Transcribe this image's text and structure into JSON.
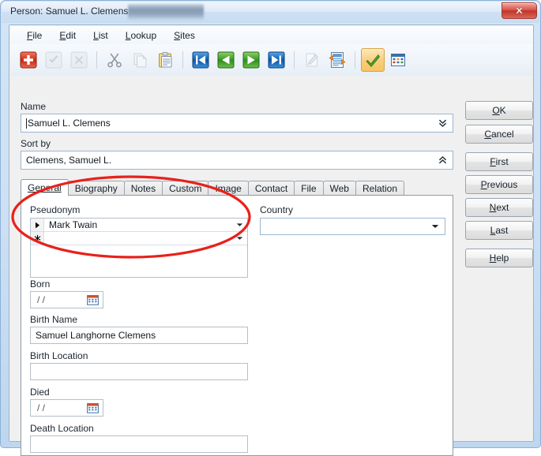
{
  "window": {
    "title": "Person: Samuel L. Clemens",
    "redacted_region": true,
    "close_label": "x"
  },
  "menubar": {
    "items": [
      {
        "label": "File",
        "accel": "F"
      },
      {
        "label": "Edit",
        "accel": "E"
      },
      {
        "label": "List",
        "accel": "L"
      },
      {
        "label": "Lookup",
        "accel": "L"
      },
      {
        "label": "Sites",
        "accel": "S"
      }
    ]
  },
  "toolbar": {
    "buttons": [
      {
        "name": "add-record-icon",
        "state": "enabled"
      },
      {
        "name": "confirm-record-icon",
        "state": "disabled"
      },
      {
        "name": "delete-record-icon",
        "state": "disabled"
      },
      {
        "name": "cut-icon",
        "state": "enabled"
      },
      {
        "name": "copy-icon",
        "state": "disabled"
      },
      {
        "name": "paste-icon",
        "state": "enabled"
      },
      {
        "name": "first-record-icon",
        "state": "enabled"
      },
      {
        "name": "previous-record-icon",
        "state": "enabled"
      },
      {
        "name": "next-record-icon",
        "state": "enabled"
      },
      {
        "name": "last-record-icon",
        "state": "enabled"
      },
      {
        "name": "edit-record-icon",
        "state": "disabled"
      },
      {
        "name": "refresh-record-icon",
        "state": "enabled"
      },
      {
        "name": "apply-check-icon",
        "state": "highlighted"
      },
      {
        "name": "grid-view-icon",
        "state": "enabled"
      }
    ]
  },
  "form": {
    "name": {
      "label": "Name",
      "value": "Samuel L. Clemens",
      "placeholder": ""
    },
    "sort_by": {
      "label": "Sort by",
      "value": "Clemens, Samuel L.",
      "placeholder": ""
    }
  },
  "tabs": {
    "items": [
      {
        "label": "General",
        "accel": "General",
        "active": true
      },
      {
        "label": "Biography",
        "active": false
      },
      {
        "label": "Notes",
        "active": false
      },
      {
        "label": "Custom",
        "active": false
      },
      {
        "label": "Image",
        "active": false
      },
      {
        "label": "Contact",
        "active": false
      },
      {
        "label": "File",
        "active": false
      },
      {
        "label": "Web",
        "active": false
      },
      {
        "label": "Relation",
        "active": false
      }
    ]
  },
  "general_tab": {
    "pseudonym": {
      "label": "Pseudonym",
      "rows": [
        {
          "marker": "▶",
          "value": "Mark Twain"
        },
        {
          "marker": "✱",
          "value": ""
        }
      ]
    },
    "country": {
      "label": "Country",
      "value": "",
      "placeholder": ""
    },
    "born": {
      "label": "Born",
      "value": "  /  /",
      "placeholder": "  /  /"
    },
    "birth_name": {
      "label": "Birth Name",
      "value": "Samuel Langhorne Clemens",
      "placeholder": ""
    },
    "birth_location": {
      "label": "Birth Location",
      "value": "",
      "placeholder": ""
    },
    "died": {
      "label": "Died",
      "value": "  /  /",
      "placeholder": "  /  /"
    },
    "death_location": {
      "label": "Death Location",
      "value": "",
      "placeholder": ""
    }
  },
  "buttons": [
    {
      "label": "OK",
      "accel": "O"
    },
    {
      "label": "Cancel",
      "accel": "C"
    },
    {
      "label": "First",
      "accel": "F"
    },
    {
      "label": "Previous",
      "accel": "P"
    },
    {
      "label": "Next",
      "accel": "N"
    },
    {
      "label": "Last",
      "accel": "L"
    },
    {
      "label": "Help",
      "accel": "H"
    }
  ],
  "annotation": {
    "shape": "ellipse",
    "color": "#e8211b",
    "target": "pseudonym-group"
  },
  "colors": {
    "window_frame": "#bed6ef",
    "titlebar": "#dfeaf8",
    "close_red": "#c03528",
    "annotation_red": "#e8211b",
    "tab_active_bg": "#ffffff",
    "field_border": "#b5bfc9"
  }
}
